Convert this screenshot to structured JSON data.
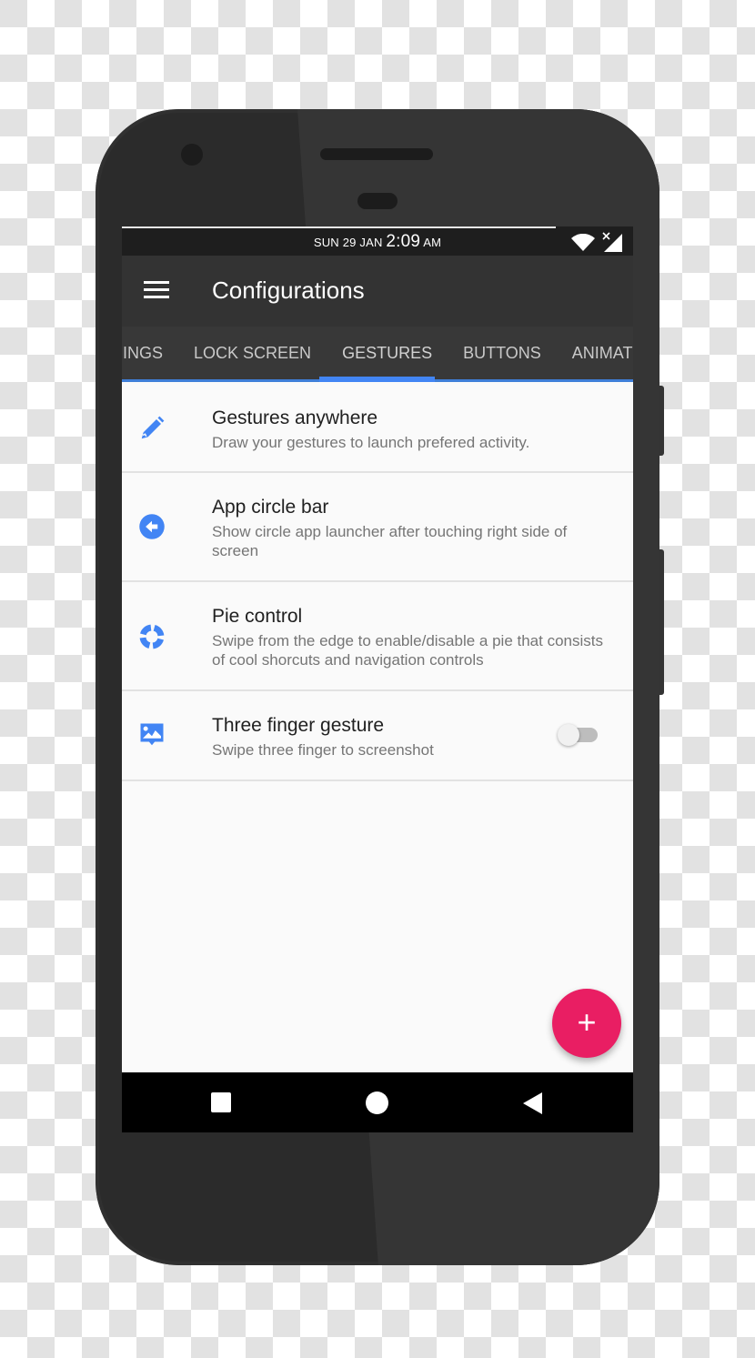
{
  "status_bar": {
    "date": "SUN 29 JAN",
    "time": "2:09",
    "ampm": "AM",
    "icons": [
      "wifi-icon",
      "cell-signal-no-service-icon"
    ]
  },
  "app_bar": {
    "menu_icon": "hamburger-menu-icon",
    "title": "Configurations"
  },
  "tabs": [
    {
      "label": "INGS",
      "active": false
    },
    {
      "label": "LOCK SCREEN",
      "active": false
    },
    {
      "label": "GESTURES",
      "active": true
    },
    {
      "label": "BUTTONS",
      "active": false
    },
    {
      "label": "ANIMATIC",
      "active": false
    }
  ],
  "items": [
    {
      "icon": "pencil-icon",
      "title": "Gestures anywhere",
      "subtitle": "Draw your gestures to launch prefered activity."
    },
    {
      "icon": "circle-arrow-left-icon",
      "title": "App circle bar",
      "subtitle": "Show circle app launcher after touching right side of screen"
    },
    {
      "icon": "pie-ring-icon",
      "title": "Pie control",
      "subtitle": "Swipe from the edge to enable/disable a pie that consists of cool shorcuts and navigation controls"
    },
    {
      "icon": "screenshot-image-icon",
      "title": "Three finger gesture",
      "subtitle": "Swipe three finger to screenshot",
      "toggle": false
    }
  ],
  "fab": {
    "label": "+",
    "icon": "plus-icon"
  },
  "nav_bar": {
    "buttons": [
      "recents-icon",
      "home-icon",
      "back-icon"
    ]
  },
  "colors": {
    "accent_blue": "#4285f4",
    "fab_pink": "#e91e63",
    "app_bar": "#333333",
    "tab_bar": "#383838"
  }
}
